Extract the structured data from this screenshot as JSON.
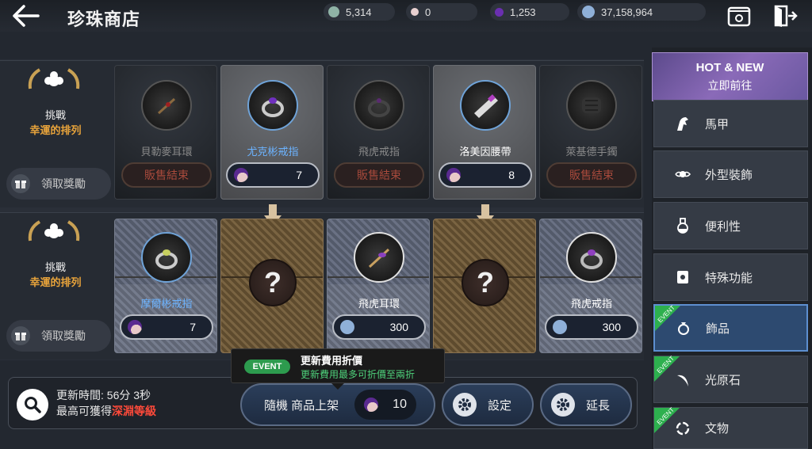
{
  "header": {
    "title": "珍珠商店",
    "currencies": [
      {
        "name": "silver-pearl",
        "value": "5,314",
        "color": "#8fb3a6"
      },
      {
        "name": "pearl",
        "value": "0",
        "color": "#e8d0d0"
      },
      {
        "name": "crystal",
        "value": "1,253",
        "color": "#6a2fb0"
      },
      {
        "name": "silver",
        "value": "37,158,964",
        "color": "#8fb0d8"
      }
    ]
  },
  "rows": [
    {
      "challenge": {
        "line1": "挑戰",
        "line2": "幸運的排列",
        "claim_label": "領取獎勵"
      },
      "cards": [
        {
          "name": "貝勒麥耳環",
          "status": "販售結束",
          "style": "dark"
        },
        {
          "name": "尤克彬戒指",
          "price": "7",
          "currency": "crystal",
          "style": "lit"
        },
        {
          "name": "飛虎戒指",
          "status": "販售結束",
          "style": "dark"
        },
        {
          "name": "洛美因腰帶",
          "price": "8",
          "currency": "crystal",
          "style": "lit"
        },
        {
          "name": "萊基德手鐲",
          "status": "販售結束",
          "style": "dark"
        }
      ]
    },
    {
      "challenge": {
        "line1": "挑戰",
        "line2": "幸運的排列",
        "claim_label": "領取獎勵"
      },
      "cards": [
        {
          "name": "摩爾彬戒指",
          "price": "7",
          "currency": "crystal",
          "style": "woven"
        },
        {
          "name": "?",
          "style": "wood"
        },
        {
          "name": "飛虎耳環",
          "price": "300",
          "currency": "silver",
          "style": "woven"
        },
        {
          "name": "?",
          "style": "wood"
        },
        {
          "name": "飛虎戒指",
          "price": "300",
          "currency": "silver",
          "style": "woven"
        }
      ]
    }
  ],
  "bottom": {
    "refresh_time": "更新時間: 56分 3秒",
    "max_prefix": "最高可獲得",
    "max_highlight": "深淵等級",
    "random_label": "隨機 商品上架",
    "random_cost": "10",
    "settings_label": "設定",
    "extend_label": "延長"
  },
  "tooltip": {
    "badge": "EVENT",
    "title": "更新費用折價",
    "subtitle": "更新費用最多可折價至兩折"
  },
  "sidebar": {
    "hot_line1": "HOT & NEW",
    "hot_line2": "立即前往",
    "items": [
      {
        "label": "馬甲",
        "icon": "horse-icon",
        "event": false,
        "active": false
      },
      {
        "label": "外型裝飾",
        "icon": "costume-icon",
        "event": false,
        "active": false
      },
      {
        "label": "便利性",
        "icon": "potion-icon",
        "event": false,
        "active": false
      },
      {
        "label": "特殊功能",
        "icon": "scroll-icon",
        "event": false,
        "active": false
      },
      {
        "label": "飾品",
        "icon": "ring-icon",
        "event": true,
        "active": true
      },
      {
        "label": "光原石",
        "icon": "crescent-icon",
        "event": true,
        "active": false
      },
      {
        "label": "文物",
        "icon": "artifact-icon",
        "event": true,
        "active": false
      }
    ],
    "event_label": "EVENT"
  }
}
